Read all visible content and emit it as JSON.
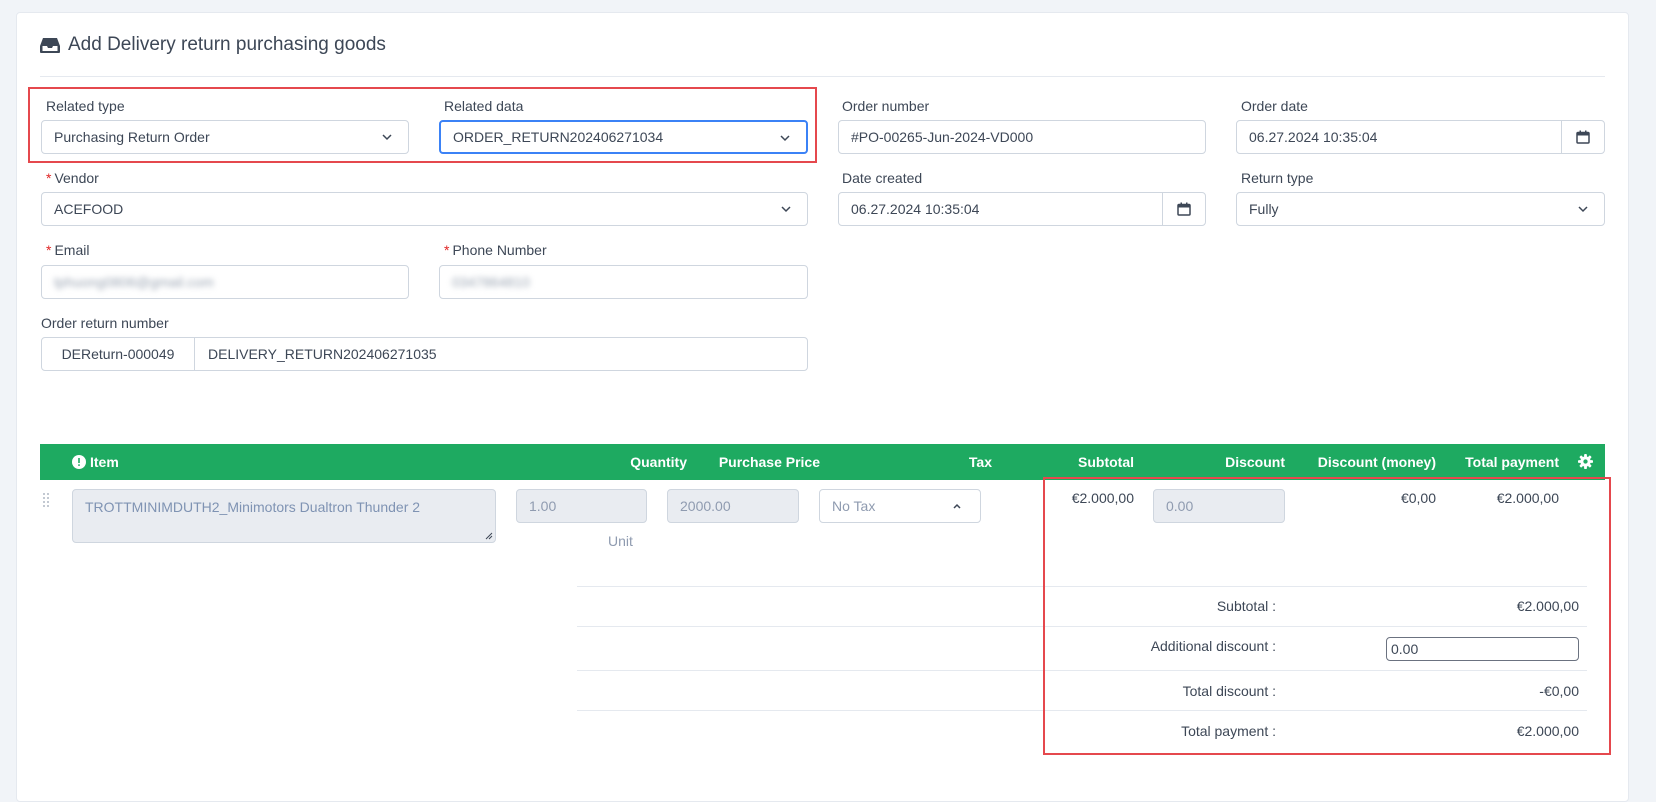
{
  "page": {
    "title": "Add Delivery return purchasing goods"
  },
  "form": {
    "related_type": {
      "label": "Related type",
      "value": "Purchasing Return Order"
    },
    "related_data": {
      "label": "Related data",
      "value": "ORDER_RETURN202406271034"
    },
    "order_number": {
      "label": "Order number",
      "value": "#PO-00265-Jun-2024-VD000"
    },
    "order_date": {
      "label": "Order date",
      "value": "06.27.2024 10:35:04"
    },
    "vendor": {
      "label": "Vendor",
      "required_mark": "*",
      "value": "ACEFOOD"
    },
    "date_created": {
      "label": "Date created",
      "value": "06.27.2024 10:35:04"
    },
    "return_type": {
      "label": "Return type",
      "value": "Fully"
    },
    "email": {
      "label": "Email",
      "required_mark": "*",
      "value": "tphuong0806@gmail.com"
    },
    "phone": {
      "label": "Phone Number",
      "required_mark": "*",
      "value": "0347864810"
    },
    "order_return_number": {
      "label": "Order return number",
      "prefix": "DEReturn-000049",
      "value": "DELIVERY_RETURN202406271035"
    }
  },
  "table": {
    "headers": {
      "item": "Item",
      "quantity": "Quantity",
      "purchase_price": "Purchase Price",
      "tax": "Tax",
      "subtotal": "Subtotal",
      "discount": "Discount",
      "discount_money": "Discount (money)",
      "total_payment": "Total payment"
    },
    "row": {
      "item": "TROTTMINIMDUTH2_Minimotors Dualtron Thunder 2",
      "quantity": "1.00",
      "unit": "Unit",
      "purchase_price": "2000.00",
      "tax": "No Tax",
      "subtotal": "€2.000,00",
      "discount": "0.00",
      "discount_money": "€0,00",
      "total_payment": "€2.000,00"
    }
  },
  "summary": {
    "subtotal_label": "Subtotal :",
    "subtotal_value": "€2.000,00",
    "additional_discount_label": "Additional discount :",
    "additional_discount_value": "0.00",
    "total_discount_label": "Total discount :",
    "total_discount_value": "-€0,00",
    "total_payment_label": "Total payment :",
    "total_payment_value": "€2.000,00"
  },
  "colors": {
    "header_green": "#1eaa61",
    "highlight_red": "#e5484d",
    "focus_blue": "#3b82f6"
  },
  "icons": [
    "inbox-icon",
    "chevron-down-icon",
    "calendar-icon",
    "info-circle-icon",
    "gear-icon",
    "drag-handle-icon",
    "chevron-up-icon"
  ]
}
